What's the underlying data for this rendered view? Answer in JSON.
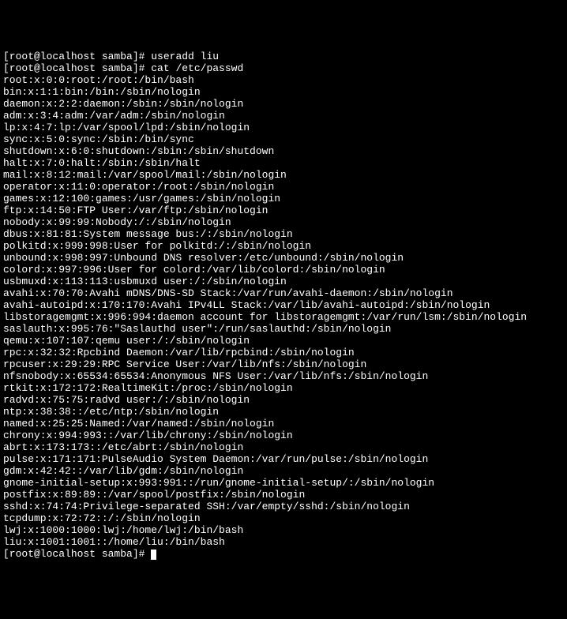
{
  "prompt1": "[root@localhost samba]# ",
  "cmd1": "useradd liu",
  "prompt2": "[root@localhost samba]# ",
  "cmd2": "cat /etc/passwd",
  "passwd_lines": [
    "root:x:0:0:root:/root:/bin/bash",
    "bin:x:1:1:bin:/bin:/sbin/nologin",
    "daemon:x:2:2:daemon:/sbin:/sbin/nologin",
    "adm:x:3:4:adm:/var/adm:/sbin/nologin",
    "lp:x:4:7:lp:/var/spool/lpd:/sbin/nologin",
    "sync:x:5:0:sync:/sbin:/bin/sync",
    "shutdown:x:6:0:shutdown:/sbin:/sbin/shutdown",
    "halt:x:7:0:halt:/sbin:/sbin/halt",
    "mail:x:8:12:mail:/var/spool/mail:/sbin/nologin",
    "operator:x:11:0:operator:/root:/sbin/nologin",
    "games:x:12:100:games:/usr/games:/sbin/nologin",
    "ftp:x:14:50:FTP User:/var/ftp:/sbin/nologin",
    "nobody:x:99:99:Nobody:/:/sbin/nologin",
    "dbus:x:81:81:System message bus:/:/sbin/nologin",
    "polkitd:x:999:998:User for polkitd:/:/sbin/nologin",
    "unbound:x:998:997:Unbound DNS resolver:/etc/unbound:/sbin/nologin",
    "colord:x:997:996:User for colord:/var/lib/colord:/sbin/nologin",
    "usbmuxd:x:113:113:usbmuxd user:/:/sbin/nologin",
    "avahi:x:70:70:Avahi mDNS/DNS-SD Stack:/var/run/avahi-daemon:/sbin/nologin",
    "avahi-autoipd:x:170:170:Avahi IPv4LL Stack:/var/lib/avahi-autoipd:/sbin/nologin",
    "libstoragemgmt:x:996:994:daemon account for libstoragemgmt:/var/run/lsm:/sbin/nologin",
    "saslauth:x:995:76:\"Saslauthd user\":/run/saslauthd:/sbin/nologin",
    "qemu:x:107:107:qemu user:/:/sbin/nologin",
    "rpc:x:32:32:Rpcbind Daemon:/var/lib/rpcbind:/sbin/nologin",
    "rpcuser:x:29:29:RPC Service User:/var/lib/nfs:/sbin/nologin",
    "nfsnobody:x:65534:65534:Anonymous NFS User:/var/lib/nfs:/sbin/nologin",
    "rtkit:x:172:172:RealtimeKit:/proc:/sbin/nologin",
    "radvd:x:75:75:radvd user:/:/sbin/nologin",
    "ntp:x:38:38::/etc/ntp:/sbin/nologin",
    "named:x:25:25:Named:/var/named:/sbin/nologin",
    "chrony:x:994:993::/var/lib/chrony:/sbin/nologin",
    "abrt:x:173:173::/etc/abrt:/sbin/nologin",
    "pulse:x:171:171:PulseAudio System Daemon:/var/run/pulse:/sbin/nologin",
    "gdm:x:42:42::/var/lib/gdm:/sbin/nologin",
    "gnome-initial-setup:x:993:991::/run/gnome-initial-setup/:/sbin/nologin",
    "postfix:x:89:89::/var/spool/postfix:/sbin/nologin",
    "sshd:x:74:74:Privilege-separated SSH:/var/empty/sshd:/sbin/nologin",
    "tcpdump:x:72:72::/:/sbin/nologin",
    "lwj:x:1000:1000:lwj:/home/lwj:/bin/bash",
    "liu:x:1001:1001::/home/liu:/bin/bash"
  ],
  "prompt3": "[root@localhost samba]# "
}
